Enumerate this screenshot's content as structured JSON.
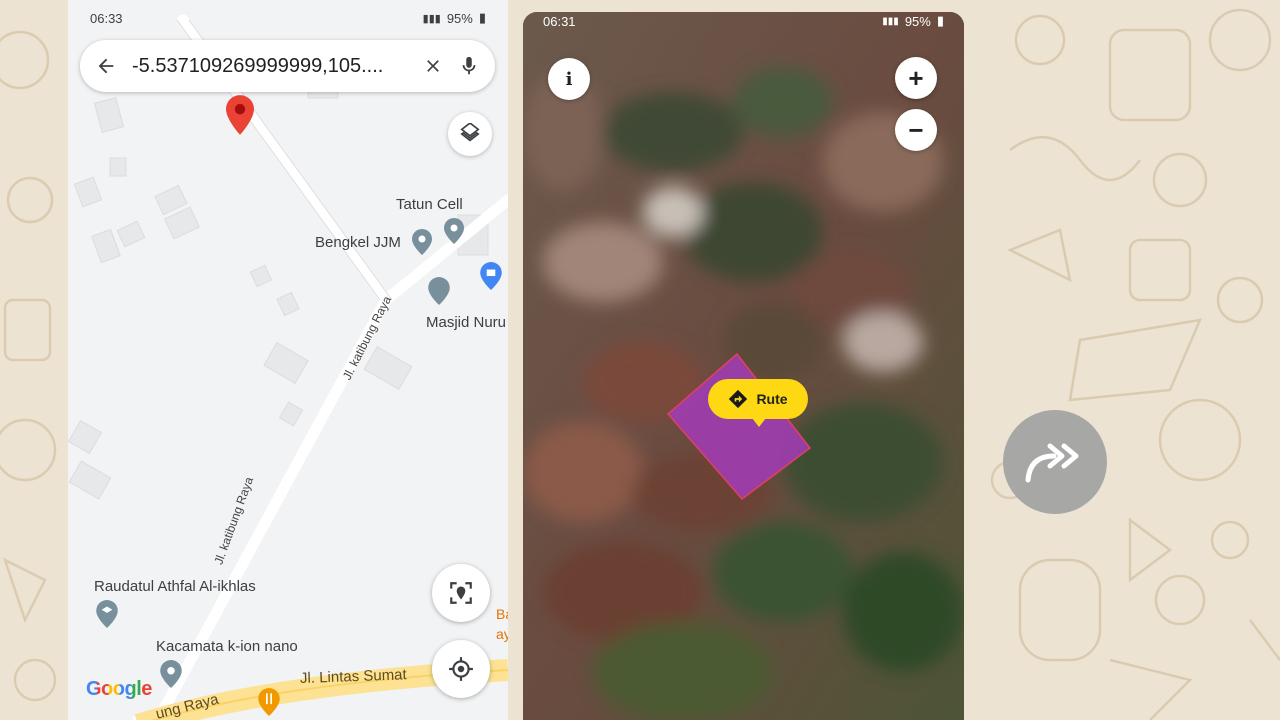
{
  "left_phone": {
    "status": {
      "time": "06:33",
      "battery": "95%"
    },
    "search": {
      "query": "-5.537109269999999,105....",
      "back_icon": "arrow-left-icon",
      "clear_icon": "close-icon",
      "mic_icon": "mic-icon"
    },
    "places": {
      "tatun_cell": "Tatun Cell",
      "bengkel": "Bengkel JJM",
      "masjid": "Masjid Nuru",
      "raudatul": "Raudatul Athfal Al-ikhlas",
      "kacamata": "Kacamata k-ion nano",
      "ba": "Ba",
      "ay": "ay"
    },
    "roads": {
      "katibung_1": "Jl. katibung Raya",
      "katibung_2": "Jl. katibung Raya",
      "lintas": "Jl. Lintas Sumat",
      "ung_raya": "ung Raya"
    },
    "brand": "Google"
  },
  "right_phone": {
    "status": {
      "time": "06:31",
      "battery": "95%"
    },
    "info_label": "i",
    "zoom_in": "+",
    "zoom_out": "−",
    "route_label": "Rute",
    "accent": "#ffd814",
    "parcel_color": "#a03cb4"
  },
  "forward_icon": "double-forward-arrow-icon"
}
